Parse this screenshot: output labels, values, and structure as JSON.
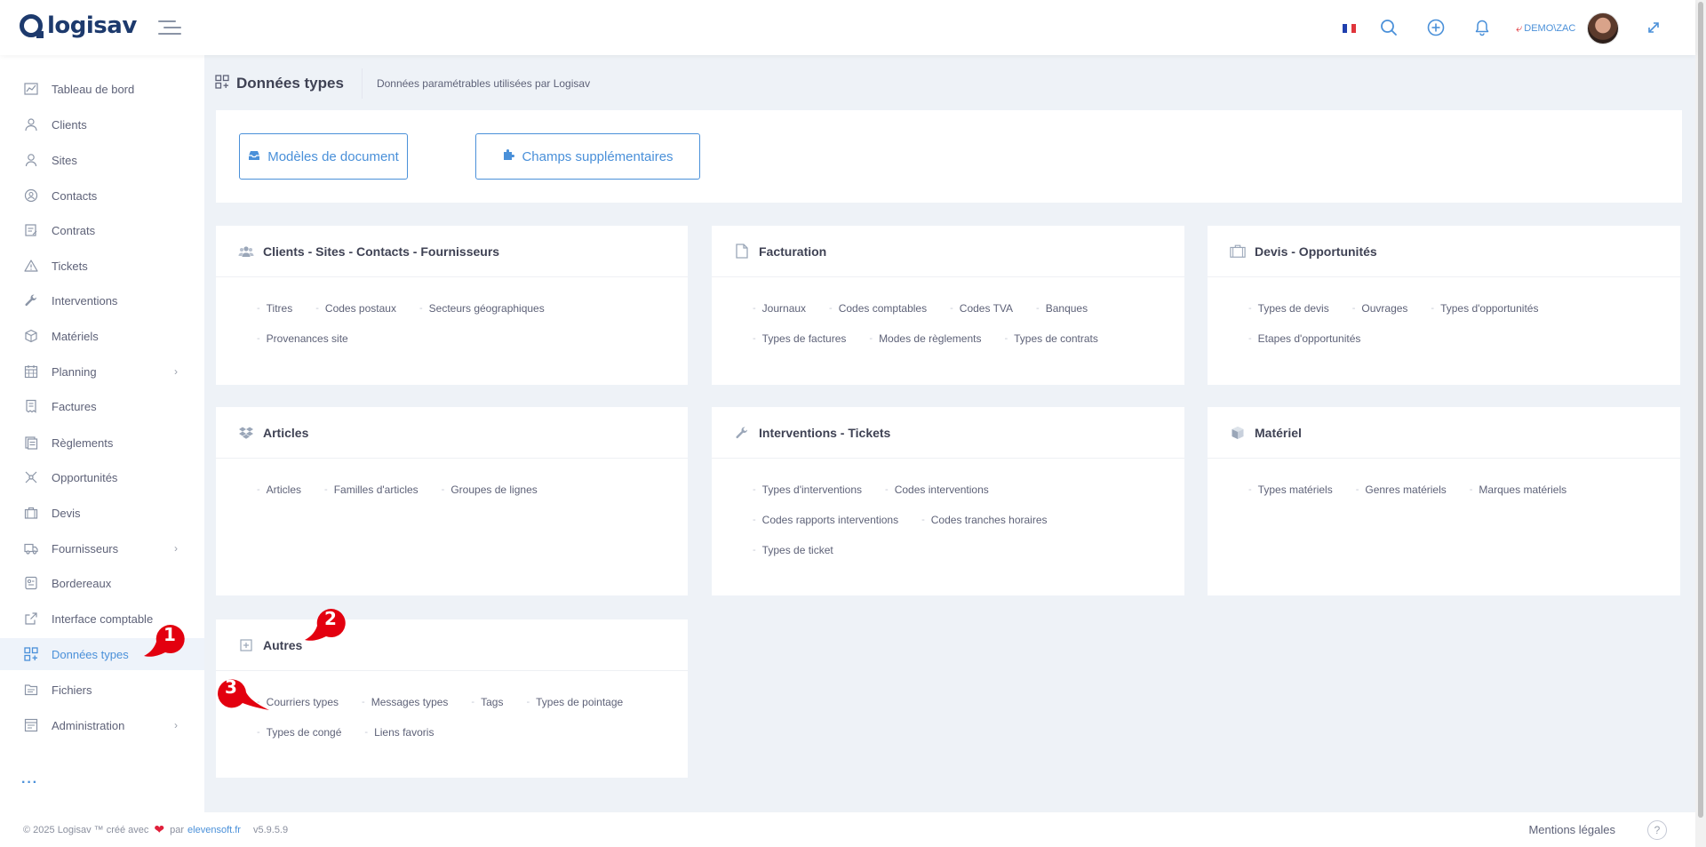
{
  "app": {
    "logo_text": "logisav"
  },
  "header": {
    "user_label": "DEMO\\ZAC",
    "flag_colors": [
      "#1f3fae",
      "#ffffff",
      "#e0353b"
    ]
  },
  "sidebar": {
    "items": [
      {
        "label": "Tableau de bord",
        "icon": "chart-icon"
      },
      {
        "label": "Clients",
        "icon": "users-icon"
      },
      {
        "label": "Sites",
        "icon": "user-icon"
      },
      {
        "label": "Contacts",
        "icon": "contact-icon"
      },
      {
        "label": "Contrats",
        "icon": "contract-icon"
      },
      {
        "label": "Tickets",
        "icon": "warning-icon"
      },
      {
        "label": "Interventions",
        "icon": "wrench-icon"
      },
      {
        "label": "Matériels",
        "icon": "box-icon"
      },
      {
        "label": "Planning",
        "icon": "calendar-icon",
        "expandable": true
      },
      {
        "label": "Factures",
        "icon": "invoice-icon"
      },
      {
        "label": "Règlements",
        "icon": "payment-icon"
      },
      {
        "label": "Opportunités",
        "icon": "opportunity-icon"
      },
      {
        "label": "Devis",
        "icon": "briefcase-icon"
      },
      {
        "label": "Fournisseurs",
        "icon": "truck-icon",
        "expandable": true
      },
      {
        "label": "Bordereaux",
        "icon": "slip-icon"
      },
      {
        "label": "Interface comptable",
        "icon": "external-icon"
      },
      {
        "label": "Données types",
        "icon": "grid-icon",
        "active": true
      },
      {
        "label": "Fichiers",
        "icon": "folder-icon"
      },
      {
        "label": "Administration",
        "icon": "admin-icon",
        "expandable": true
      }
    ],
    "more": "···"
  },
  "page": {
    "title": "Données types",
    "subtitle": "Données paramétrables utilisées par Logisav"
  },
  "toolbar": {
    "documents_label": "Modèles de document",
    "fields_label": "Champs supplémentaires"
  },
  "cards": [
    {
      "title": "Clients - Sites - Contacts - Fournisseurs",
      "links": [
        "Titres",
        "Codes postaux",
        "Secteurs géographiques",
        "Provenances site"
      ]
    },
    {
      "title": "Facturation",
      "links": [
        "Journaux",
        "Codes comptables",
        "Codes TVA",
        "Banques",
        "Types de factures",
        "Modes de règlements",
        "Types de contrats"
      ]
    },
    {
      "title": "Devis - Opportunités",
      "links": [
        "Types de devis",
        "Ouvrages",
        "Types d'opportunités",
        "Etapes d'opportunités"
      ]
    },
    {
      "title": "Articles",
      "links": [
        "Articles",
        "Familles d'articles",
        "Groupes de lignes"
      ]
    },
    {
      "title": "Interventions - Tickets",
      "links": [
        "Types d'interventions",
        "Codes interventions",
        "Codes rapports interventions",
        "Codes tranches horaires",
        "Types de ticket"
      ]
    },
    {
      "title": "Matériel",
      "links": [
        "Types matériels",
        "Genres matériels",
        "Marques matériels"
      ]
    },
    {
      "title": "Autres",
      "links": [
        "Courriers types",
        "Messages types",
        "Tags",
        "Types de pointage",
        "Types de congé",
        "Liens favoris"
      ]
    }
  ],
  "annotations": [
    "1",
    "2",
    "3"
  ],
  "footer": {
    "copyright": "© 2025 Logisav ™ créé avec",
    "by": "par",
    "brand": "elevensoft.fr",
    "version": "v5.9.5.9",
    "legal": "Mentions légales",
    "help": "?"
  },
  "colors": {
    "accent": "#4a90d9",
    "brand": "#1d3a6d",
    "badge": "#e3000f"
  }
}
